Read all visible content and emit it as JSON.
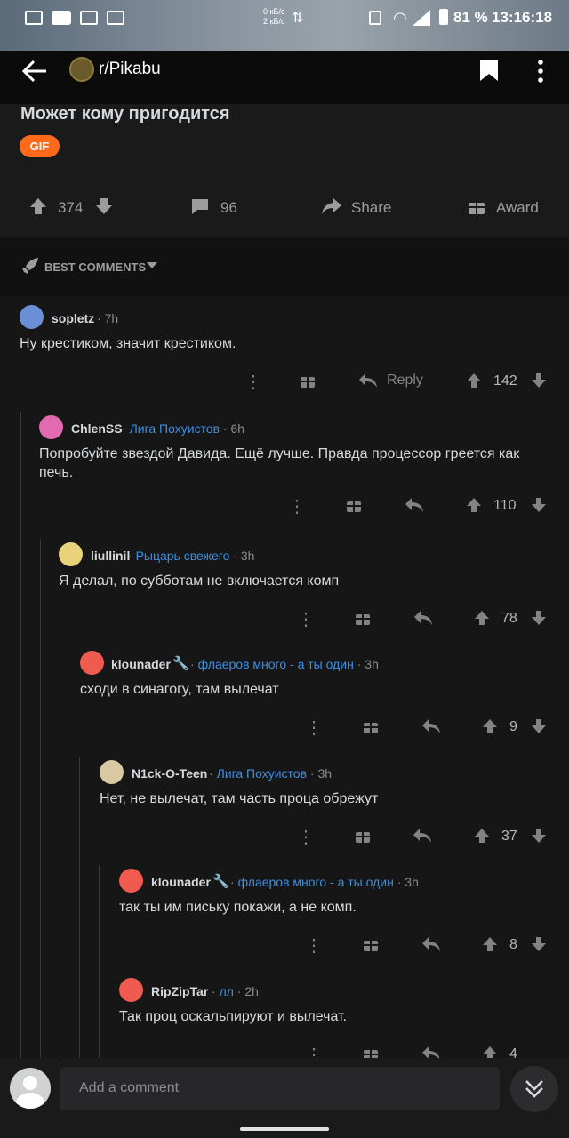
{
  "status_bar": {
    "net_up": "0 кБ/с",
    "net_down": "2 кБ/с",
    "battery": "81 %",
    "time": "13:16:18"
  },
  "header": {
    "subreddit": "r/Pikabu"
  },
  "post": {
    "title": "Может кому пригодится",
    "flair": "GIF",
    "votes": "374",
    "comments": "96",
    "share_label": "Share",
    "award_label": "Award"
  },
  "sort": {
    "label": "BEST COMMENTS"
  },
  "comments": [
    {
      "user": "sopletz",
      "flair": "",
      "time": "7h",
      "text": "Ну крестиком, значит крестиком.",
      "votes": "142",
      "reply_label": "Reply"
    },
    {
      "user": "ChlenSS",
      "flair": "Лига Похуистов",
      "time": "6h",
      "text": "Попробуйте звездой Давида. Ещё лучше. Правда процессор греется как печь.",
      "votes": "110"
    },
    {
      "user": "liullinil",
      "flair": "Рыцарь свежего",
      "time": "3h",
      "text": "Я делал, по субботам не включается комп",
      "votes": "78"
    },
    {
      "user": "klounader",
      "flair": "флаеров много - а ты один",
      "time": "3h",
      "text": "сходи в синагогу, там вылечат",
      "votes": "9"
    },
    {
      "user": "N1ck-O-Teen",
      "flair": "Лига Похуистов",
      "time": "3h",
      "text": "Нет, не вылечат, там часть проца обрежут",
      "votes": "37"
    },
    {
      "user": "klounader",
      "flair": "флаеров много - а ты один",
      "time": "3h",
      "text": "так ты им письку покажи, а не комп.",
      "votes": "8"
    },
    {
      "user": "RipZipTar",
      "flair": "лл",
      "time": "2h",
      "text": "Так проц оскальпируют и вылечат.",
      "votes": "4"
    }
  ],
  "composer": {
    "placeholder": "Add a comment"
  },
  "colors": {
    "accent": "#ff6a1a",
    "flair_blue": "#3d8fe0"
  }
}
